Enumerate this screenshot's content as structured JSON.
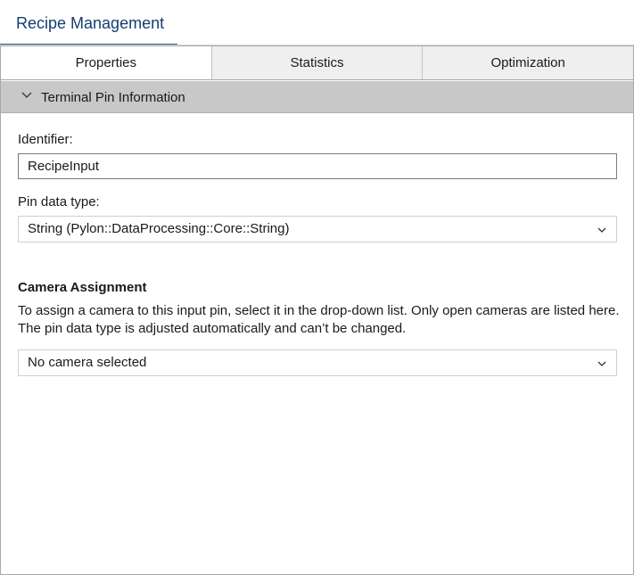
{
  "header": {
    "title": "Recipe Management"
  },
  "tabs": [
    {
      "label": "Properties"
    },
    {
      "label": "Statistics"
    },
    {
      "label": "Optimization"
    }
  ],
  "section": {
    "title": "Terminal Pin Information"
  },
  "identifier": {
    "label": "Identifier:",
    "value": "RecipeInput"
  },
  "pin_data_type": {
    "label": "Pin data type:",
    "value": "String (Pylon::DataProcessing::Core::String)"
  },
  "camera": {
    "heading": "Camera Assignment",
    "description_line1": "To assign a camera to this input pin, select it in the drop-down list. Only open cameras are listed here.",
    "description_line2": "The pin data type is adjusted automatically and can’t be changed.",
    "value": "No camera selected"
  },
  "colors": {
    "accent": "#1b5a9a",
    "section_bg": "#c8c8c8"
  }
}
